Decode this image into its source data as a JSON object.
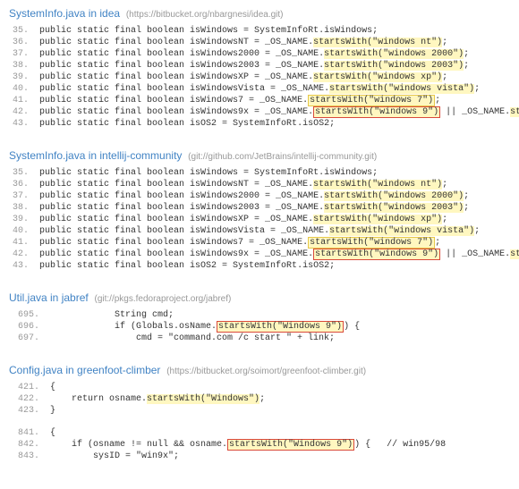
{
  "results": [
    {
      "title": "SystemInfo.java in idea",
      "path": "(https://bitbucket.org/nbargnesi/idea.git)",
      "lines": [
        {
          "n": "35.",
          "code": "public static final boolean isWindows = SystemInfoRt.isWindows;",
          "hl": []
        },
        {
          "n": "36.",
          "code": "public static final boolean isWindowsNT = _OS_NAME.startsWith(\"windows nt\");",
          "hl": [
            {
              "t": "startsWith(\"windows nt\")",
              "c": "hl-y"
            }
          ]
        },
        {
          "n": "37.",
          "code": "public static final boolean isWindows2000 = _OS_NAME.startsWith(\"windows 2000\");",
          "hl": [
            {
              "t": "startsWith(\"windows 2000\")",
              "c": "hl-y"
            }
          ]
        },
        {
          "n": "38.",
          "code": "public static final boolean isWindows2003 = _OS_NAME.startsWith(\"windows 2003\");",
          "hl": [
            {
              "t": "startsWith(\"windows 2003\")",
              "c": "hl-y"
            }
          ]
        },
        {
          "n": "39.",
          "code": "public static final boolean isWindowsXP = _OS_NAME.startsWith(\"windows xp\");",
          "hl": [
            {
              "t": "startsWith(\"windows xp\")",
              "c": "hl-y"
            }
          ]
        },
        {
          "n": "40.",
          "code": "public static final boolean isWindowsVista = _OS_NAME.startsWith(\"windows vista\");",
          "hl": [
            {
              "t": "startsWith(\"windows vista\")",
              "c": "hl-y"
            }
          ]
        },
        {
          "n": "41.",
          "code": "public static final boolean isWindows7 = _OS_NAME.startsWith(\"windows 7\");",
          "hl": [
            {
              "t": "startsWith(\"windows 7\")",
              "c": "hl-box-y"
            }
          ]
        },
        {
          "n": "42.",
          "code": "public static final boolean isWindows9x = _OS_NAME.startsWith(\"windows 9\") || _OS_NAME.startsWith(\"windows me\");",
          "hl": [
            {
              "t": "startsWith(\"windows 9\")",
              "c": "hl-box-r"
            },
            {
              "t": "startsWith(\"windows me\")",
              "c": "hl-y"
            }
          ]
        },
        {
          "n": "43.",
          "code": "public static final boolean isOS2 = SystemInfoRt.isOS2;",
          "hl": []
        }
      ]
    },
    {
      "title": "SystemInfo.java in intellij-community",
      "path": "(git://github.com/JetBrains/intellij-community.git)",
      "lines": [
        {
          "n": "35.",
          "code": "public static final boolean isWindows = SystemInfoRt.isWindows;",
          "hl": []
        },
        {
          "n": "36.",
          "code": "public static final boolean isWindowsNT = _OS_NAME.startsWith(\"windows nt\");",
          "hl": [
            {
              "t": "startsWith(\"windows nt\")",
              "c": "hl-y"
            }
          ]
        },
        {
          "n": "37.",
          "code": "public static final boolean isWindows2000 = _OS_NAME.startsWith(\"windows 2000\");",
          "hl": [
            {
              "t": "startsWith(\"windows 2000\")",
              "c": "hl-y"
            }
          ]
        },
        {
          "n": "38.",
          "code": "public static final boolean isWindows2003 = _OS_NAME.startsWith(\"windows 2003\");",
          "hl": [
            {
              "t": "startsWith(\"windows 2003\")",
              "c": "hl-y"
            }
          ]
        },
        {
          "n": "39.",
          "code": "public static final boolean isWindowsXP = _OS_NAME.startsWith(\"windows xp\");",
          "hl": [
            {
              "t": "startsWith(\"windows xp\")",
              "c": "hl-y"
            }
          ]
        },
        {
          "n": "40.",
          "code": "public static final boolean isWindowsVista = _OS_NAME.startsWith(\"windows vista\");",
          "hl": [
            {
              "t": "startsWith(\"windows vista\")",
              "c": "hl-y"
            }
          ]
        },
        {
          "n": "41.",
          "code": "public static final boolean isWindows7 = _OS_NAME.startsWith(\"windows 7\");",
          "hl": [
            {
              "t": "startsWith(\"windows 7\")",
              "c": "hl-box-y"
            }
          ]
        },
        {
          "n": "42.",
          "code": "public static final boolean isWindows9x = _OS_NAME.startsWith(\"windows 9\") || _OS_NAME.startsWith(\"windows me\");",
          "hl": [
            {
              "t": "startsWith(\"windows 9\")",
              "c": "hl-box-r"
            },
            {
              "t": "startsWith(\"windows me\")",
              "c": "hl-y"
            }
          ]
        },
        {
          "n": "43.",
          "code": "public static final boolean isOS2 = SystemInfoRt.isOS2;",
          "hl": []
        }
      ]
    },
    {
      "title": "Util.java in jabref",
      "path": "(git://pkgs.fedoraproject.org/jabref)",
      "lines": [
        {
          "n": "695.",
          "code": "            String cmd;",
          "hl": []
        },
        {
          "n": "696.",
          "code": "            if (Globals.osName.startsWith(\"Windows 9\")) {",
          "hl": [
            {
              "t": "startsWith(\"Windows 9\")",
              "c": "hl-box-r"
            }
          ]
        },
        {
          "n": "697.",
          "code": "                cmd = \"command.com /c start \" + link;",
          "hl": []
        }
      ]
    },
    {
      "title": "Config.java in greenfoot-climber",
      "path": "(https://bitbucket.org/soimort/greenfoot-climber.git)",
      "lines": [
        {
          "n": "421.",
          "code": "{",
          "hl": []
        },
        {
          "n": "422.",
          "code": "    return osname.startsWith(\"Windows\");",
          "hl": [
            {
              "t": "startsWith(\"Windows\")",
              "c": "hl-y"
            }
          ]
        },
        {
          "n": "423.",
          "code": "}",
          "hl": []
        },
        {
          "gap": true
        },
        {
          "n": "841.",
          "code": "{",
          "hl": []
        },
        {
          "n": "842.",
          "code": "    if (osname != null && osname.startsWith(\"Windows 9\")) {   // win95/98",
          "hl": [
            {
              "t": "startsWith(\"Windows 9\")",
              "c": "hl-box-r"
            }
          ]
        },
        {
          "n": "843.",
          "code": "        sysID = \"win9x\";",
          "hl": []
        }
      ]
    }
  ]
}
